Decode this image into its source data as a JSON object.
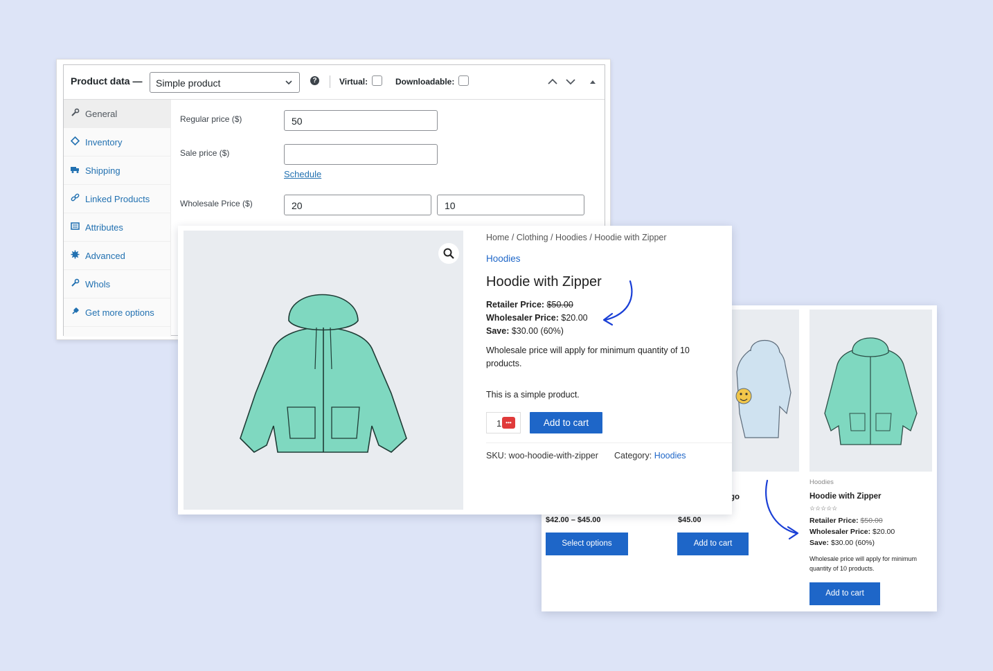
{
  "admin": {
    "title": "Product data —",
    "product_type": "Simple product",
    "help_glyph": "?",
    "virtual_label": "Virtual:",
    "downloadable_label": "Downloadable:",
    "tabs": [
      {
        "label": "General",
        "icon": "wrench-icon",
        "active": true
      },
      {
        "label": "Inventory",
        "icon": "tag-icon"
      },
      {
        "label": "Shipping",
        "icon": "truck-icon"
      },
      {
        "label": "Linked Products",
        "icon": "link-icon"
      },
      {
        "label": "Attributes",
        "icon": "list-icon"
      },
      {
        "label": "Advanced",
        "icon": "gear-icon"
      },
      {
        "label": "Whols",
        "icon": "wrench-icon"
      },
      {
        "label": "Get more options",
        "icon": "plug-icon"
      }
    ],
    "fields": {
      "regular_price_label": "Regular price ($)",
      "regular_price_value": "50",
      "sale_price_label": "Sale price ($)",
      "sale_price_value": "",
      "schedule_link": "Schedule",
      "wholesale_price_label": "Wholesale Price ($)",
      "wholesale_price_value": "20",
      "wholesale_min_qty_value": "10"
    }
  },
  "product": {
    "breadcrumb": "Home / Clothing / Hoodies / Hoodie with Zipper",
    "category": "Hoodies",
    "title": "Hoodie with Zipper",
    "retailer_label": "Retailer Price:",
    "retailer_price": "$50.00",
    "wholesaler_label": "Wholesaler Price:",
    "wholesaler_price": "$20.00",
    "save_label": "Save:",
    "save_value": "$30.00 (60%)",
    "wholesale_notice": "Wholesale price will apply for minimum quantity of 10 products.",
    "short_description": "This is a simple product.",
    "quantity": "1",
    "qty_badge": "•••",
    "add_to_cart": "Add to cart",
    "sku_label": "SKU:",
    "sku_value": "woo-hoodie-with-zipper",
    "category_label": "Category:",
    "category_value": "Hoodies"
  },
  "shop": {
    "tiles": [
      {
        "price": "$42.00 – $45.00",
        "button": "Select options"
      },
      {
        "name_partial": "go",
        "price": "$45.00",
        "button": "Add to cart"
      },
      {
        "category": "Hoodies",
        "title": "Hoodie with Zipper",
        "stars": "☆☆☆☆☆",
        "retailer_label": "Retailer Price:",
        "retailer_price": "$50.00",
        "wholesaler_label": "Wholesaler Price:",
        "wholesaler_price": "$20.00",
        "save_label": "Save:",
        "save_value": "$30.00 (60%)",
        "notice": "Wholesale price will apply for minimum quantity of 10 products.",
        "button": "Add to cart"
      }
    ]
  },
  "colors": {
    "background": "#dde4f7",
    "link_blue": "#2271b1",
    "button_blue": "#1e66c8",
    "arrow_blue": "#1a3fd6",
    "hoodie_green": "#7fd8c0"
  }
}
